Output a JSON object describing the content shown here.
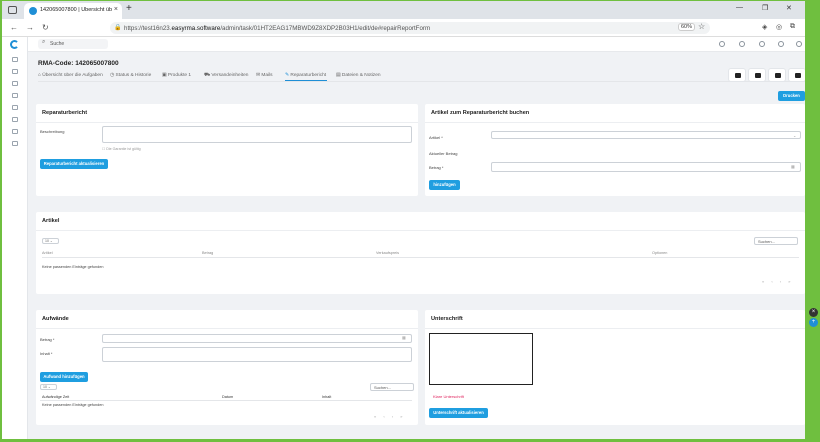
{
  "browser": {
    "tab_title": "142065007800 | Übersicht über...",
    "new_tab": "+",
    "tab_close": "×",
    "url_host": "https://test16n23.",
    "url_domain": "easyrma.software",
    "url_path": "/admin/task/01HT2EAG17MBWD9Z8XDP2B03H1/edit/de#repairReportForm",
    "zoom": "60%",
    "window_min": "—",
    "window_max": "❐",
    "window_close": "✕"
  },
  "app": {
    "search_placeholder": "Suche",
    "rma_code": "RMA-Code: 142065007800",
    "print_button": "Drucken"
  },
  "tabs": [
    {
      "label": "Übersicht über die Aufgaben",
      "icon": "home-icon"
    },
    {
      "label": "Status & Historie",
      "icon": "history-icon"
    },
    {
      "label": "Produkte 1",
      "icon": "box-icon"
    },
    {
      "label": "Versandeinheiten",
      "icon": "truck-icon"
    },
    {
      "label": "Mails",
      "icon": "mail-icon"
    },
    {
      "label": "Reparaturbericht",
      "icon": "wrench-icon",
      "active": true
    },
    {
      "label": "Dateien & Notizen",
      "icon": "file-icon"
    }
  ],
  "repair_report": {
    "title": "Reparaturbericht",
    "description_label": "Beschreibung",
    "warranty_hint": "Die Garantie ist gültig",
    "update_button": "Reparaturbericht aktualisieren"
  },
  "book_article": {
    "title": "Artikel zum Reparaturbericht buchen",
    "article_label": "Artikel *",
    "current_amount_label": "Aktueller Betrag",
    "amount_label": "Betrag *",
    "add_button": "hinzufügen"
  },
  "articles": {
    "title": "Artikel",
    "page_length": "10",
    "search_placeholder": "Suchen...",
    "columns": [
      "Artikel",
      "Betrag",
      "Verkaufspreis",
      "Optionen"
    ],
    "empty_text": "Keine passenden Einträge gefunden",
    "pager": "« ‹ › »"
  },
  "expenses": {
    "title": "Aufwände",
    "amount_label": "Betrag *",
    "content_label": "Inhalt *",
    "add_button": "Aufwand hinzufügen",
    "page_length": "10",
    "search_placeholder": "Suchen...",
    "columns": [
      "Aufwändige Zeit",
      "Datum",
      "Inhalt"
    ],
    "empty_text": "Keine passenden Einträge gefunden",
    "pager": "« ‹ › »"
  },
  "signature": {
    "title": "Unterschrift",
    "clear_link": "Klare Unterschrift",
    "update_button": "Unterschrift aktualisieren"
  },
  "colors": {
    "accent": "#1f9ee0",
    "clear_link": "#e0245e",
    "fab_close": "#333333",
    "fab_add": "#1f8fd6"
  }
}
